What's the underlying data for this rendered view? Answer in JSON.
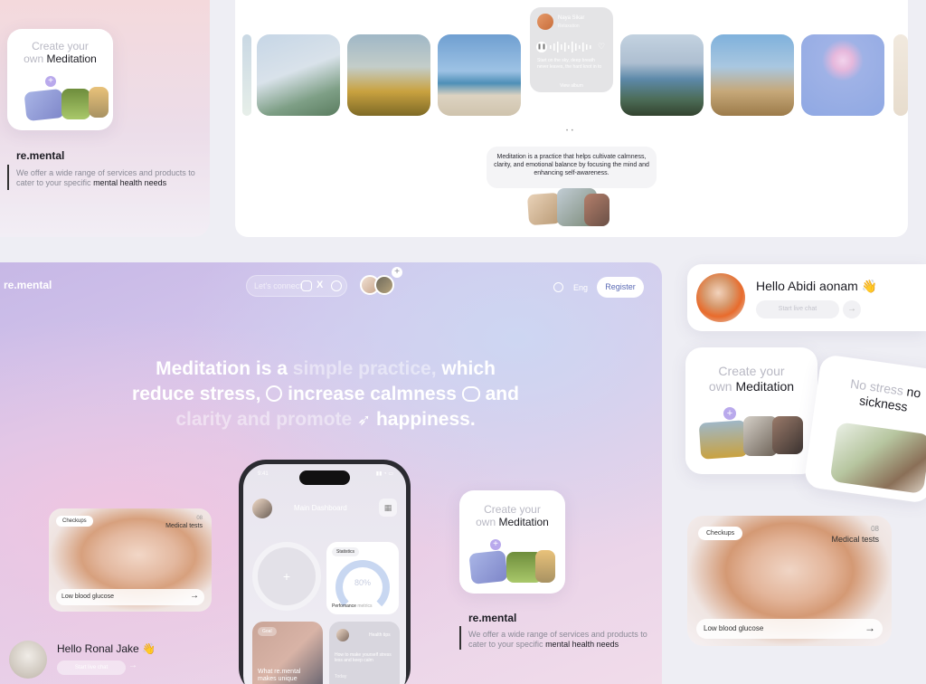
{
  "topleft": {
    "create_title_pre": "Create your",
    "create_title_pre2": "own",
    "create_title_em": "Meditation",
    "brand": "re.mental",
    "desc_pre": "We offer a wide range of services and products to cater to your specific",
    "desc_em": "mental health needs"
  },
  "topgallery": {
    "player_name": "Naya Sikar",
    "player_sub": "Relaxation",
    "player_text": "Start on the sky, deep breath never leaves, the hard knot in to",
    "player_link": "View album",
    "quote": "Meditation is a practice that helps cultivate calmness, clarity, and emotional balance by focusing the mind and enhancing self-awareness."
  },
  "hero": {
    "brand": "re.mental",
    "connect": "Let's connect",
    "lang": "Eng",
    "register": "Register",
    "line1_a": "Meditation is a",
    "line1_b": "simple practice,",
    "line1_c": "which",
    "line2_a": "reduce stress,",
    "line2_b": "increase calmness",
    "line2_c": "and",
    "line3_a": "clarity and promote",
    "line3_b": "happiness."
  },
  "checkups": {
    "tag": "Checkups",
    "num": "08",
    "label": "Medical tests",
    "glucose": "Low blood glucose"
  },
  "phone": {
    "time": "9:41",
    "title": "Main Dashboard",
    "stats": "Statistics",
    "percent": "80%",
    "perf": "Perfomance",
    "perf2": "metrics",
    "goal": "Goal",
    "goal_text": "What re.mental makes unique",
    "tips": "Health tips",
    "tips_text": "How to make yourself stress less and keep calm",
    "tips_date": "Today"
  },
  "heromid": {
    "create_pre": "Create your",
    "create_pre2": "own",
    "create_em": "Meditation",
    "brand": "re.mental",
    "desc_pre": "We offer a wide range of services and products to cater to your specific",
    "desc_em": "mental health needs"
  },
  "greet1": {
    "hello": "Hello Ronal Jake",
    "live": "Start live chat"
  },
  "greet2": {
    "hello": "Hello Abidi aonam",
    "live": "Start live chat"
  },
  "right": {
    "create_pre": "Create your",
    "create_pre2": "own",
    "create_em": "Meditation",
    "nostress_a": "No stress",
    "nostress_b": "no",
    "nostress_c": "sickness"
  },
  "colors": {
    "accent": "#4d4c5e",
    "sky": "#d7dcf2",
    "pink": "#f3dde6"
  }
}
